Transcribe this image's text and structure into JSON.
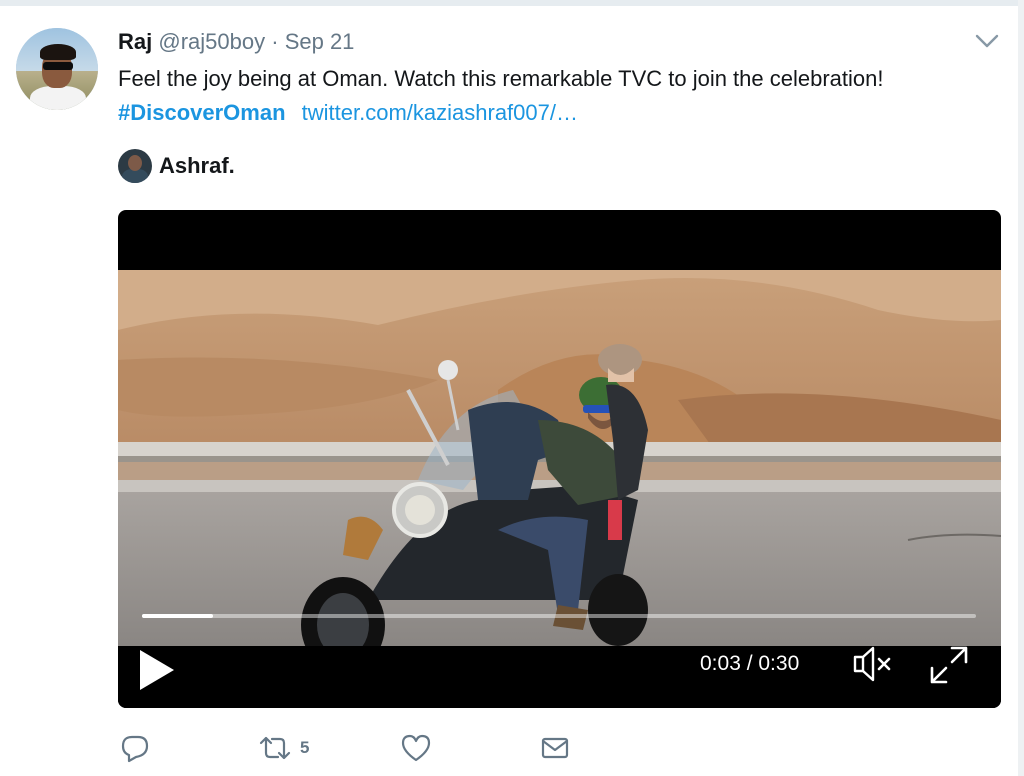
{
  "tweet": {
    "author_name": "Raj",
    "author_handle": "@raj50boy",
    "separator": "·",
    "date": "Sep 21",
    "text": "Feel the joy being at Oman. Watch this remarkable TVC to join the celebration!",
    "hashtag": "#DiscoverOman",
    "link": "twitter.com/kaziashraf007/…"
  },
  "quoted": {
    "name": "Ashraf."
  },
  "video": {
    "time": "0:03 / 0:30",
    "progress": 0.085,
    "muted": true
  },
  "actions": {
    "reply_icon": "reply-icon",
    "retweet_icon": "retweet-icon",
    "retweet_count": "5",
    "like_icon": "heart-icon",
    "dm_icon": "envelope-icon"
  },
  "colors": {
    "link": "#1b95e0",
    "secondary_text": "#657786",
    "primary_text": "#14171a"
  }
}
